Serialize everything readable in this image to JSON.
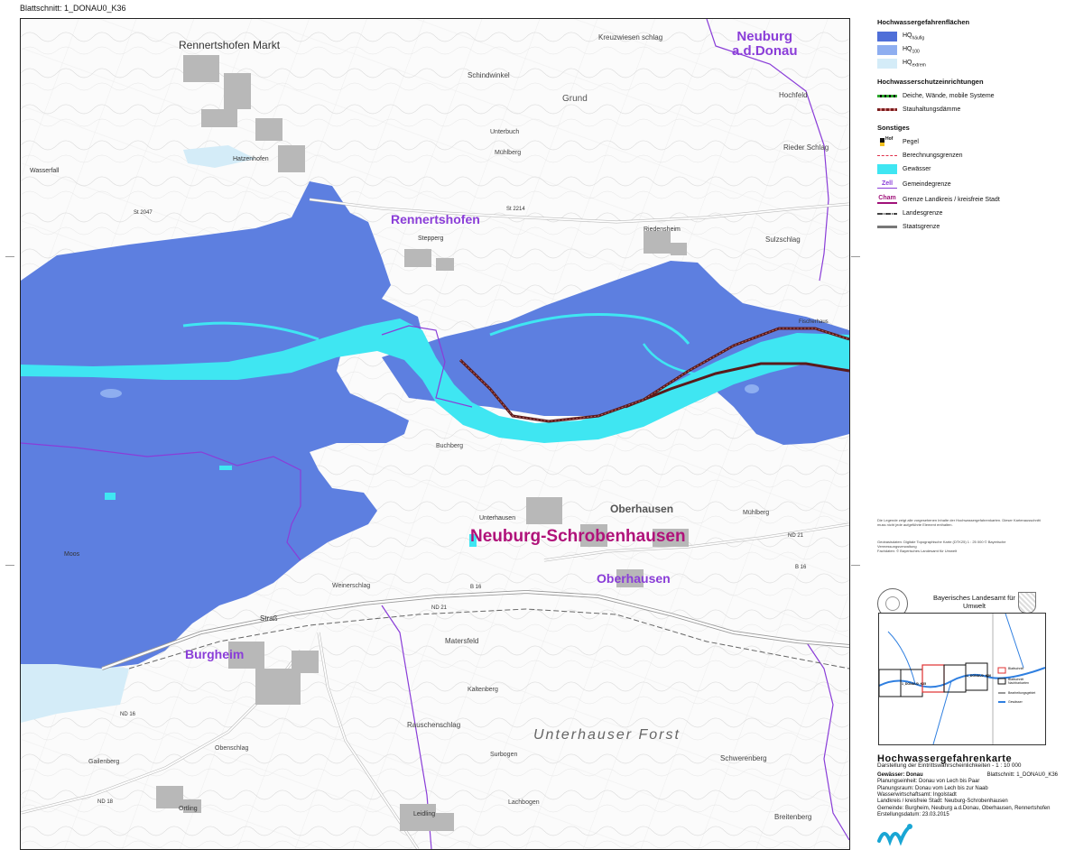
{
  "sheet": {
    "title": "Blattschnitt: 1_DONAU0_K36"
  },
  "map": {
    "place_labels": [
      {
        "text": "Neuburg\na.d.Donau",
        "style": "purple",
        "size": 15
      },
      {
        "text": "Rennertshofen",
        "style": "purple",
        "size": 14
      },
      {
        "text": "Neuburg-Schrobenhausen",
        "style": "magenta",
        "size": 19
      },
      {
        "text": "Oberhausen",
        "style": "purple",
        "size": 14
      },
      {
        "text": "Burgheim",
        "style": "purple",
        "size": 14
      }
    ],
    "road_labels": [
      "St 2214",
      "St 2214",
      "ND 21",
      "ND 21",
      "B 16",
      "B 16",
      "ND 18",
      "ND 16",
      "St 2047"
    ],
    "map_text": [
      "Rennertshofen Markt",
      "Hatzenhofen",
      "Stepperg",
      "Riedensheim",
      "Oberhausen",
      "Unterhausen",
      "Straß",
      "Ortling",
      "Leidling",
      "Unterhauser Forst",
      "Schindwinkel",
      "Grund",
      "Kreuzwiesen schlag",
      "Rieder Schlag",
      "Hochfeld",
      "Sulzschlag",
      "Unterbuch",
      "Mühlberg",
      "Kaltenberg",
      "Weinerschlag",
      "Matersfeld",
      "Rauschenschlag",
      "Lachbogen",
      "Buchberg",
      "Mühlberg",
      "Breitenberg",
      "Schwerenberg",
      "Gailenberg",
      "Obenschlag",
      "Surbogen",
      "Moos",
      "Wasserfall",
      "Fischerhaus"
    ]
  },
  "legend": {
    "section1_title": "Hochwassergefahrenflächen",
    "hq_items": [
      {
        "main": "HQ",
        "sub": "häufig",
        "color": "#4f6fd8"
      },
      {
        "main": "HQ",
        "sub": "100",
        "color": "#8eaef0"
      },
      {
        "main": "HQ",
        "sub": "extrem",
        "color": "#d4ecf8"
      }
    ],
    "section2_title": "Hochwasserschutzeinrichtungen",
    "protection_items": [
      {
        "label": "Deiche, Wände, mobile Systeme",
        "color": "#2da82d"
      },
      {
        "label": "Stauhaltungsdämme",
        "color": "#7a1f1f"
      }
    ],
    "section3_title": "Sonstiges",
    "other_items": [
      {
        "label": "Pegel",
        "symbol": "Hof"
      },
      {
        "label": "Berechnungsgrenzen",
        "color": "#e0304a"
      },
      {
        "label": "Gewässer",
        "color": "#3fe6f2"
      },
      {
        "label": "Gemeindegrenze",
        "symbol": "Zell"
      },
      {
        "label": "Grenze Landkreis / kreisfreie Stadt",
        "symbol": "Cham"
      },
      {
        "label": "Landesgrenze",
        "color": "#444444"
      },
      {
        "label": "Staatsgrenze",
        "color": "#777777"
      }
    ]
  },
  "agency": {
    "name": "Bayerisches Landesamt für\nUmwelt"
  },
  "overview": {
    "sheet_labels": [
      "1_DONAU0_K35",
      "1_DONAU0_K36"
    ],
    "legend": [
      "Blattschnitt",
      "Blattschnitt Nachbarkarten",
      "Bearbeitungsgebiet",
      "Gewässer"
    ]
  },
  "footer": {
    "title": "Hochwassergefahrenkarte",
    "subtitle": "Darstellung der Eintrittswahrscheinlichkeiten - 1 : 10 000",
    "gewaesser_label": "Gewässer: Donau",
    "blatt_label": "Blattschnitt: 1_DONAU0_K36",
    "lines": [
      "Planungseinheit: Donau von Lech bis Paar",
      "Planungsraum:   Donau vom Lech bis zur Naab",
      "Wasserwirtschaftsamt:   Ingolstadt",
      "Landkreis / kreisfreie Stadt:   Neuburg-Schrobenhausen",
      "Gemeinde:   Burgheim, Neuburg a.d.Donau, Oberhausen, Rennertshofen",
      "Erstellungsdatum: 23.03.2015"
    ]
  },
  "notes": {
    "legend_note": "Die Legende zeigt alle vorgesehenen Inhalte der Hochwassergefahrenkarten. Dieser Kartenausschnitt muss nicht jede aufgeführte Element enthalten.",
    "basis": "Geobasisdaten: Digitale Topographische Karte (DTK25) 1 : 25 000 © Bayerische Vermessungsverwaltung",
    "fachdaten": "Fachdaten: © Bayerisches Landesamt für Umwelt"
  },
  "colors": {
    "hq_haeufig": "#5d7fe0",
    "hq_100": "#8eaef0",
    "hq_extrem": "#d4ecf8",
    "water": "#3fe6f2",
    "dam": "#5a1a1a",
    "admin_boundary": "#8a3dd8"
  }
}
